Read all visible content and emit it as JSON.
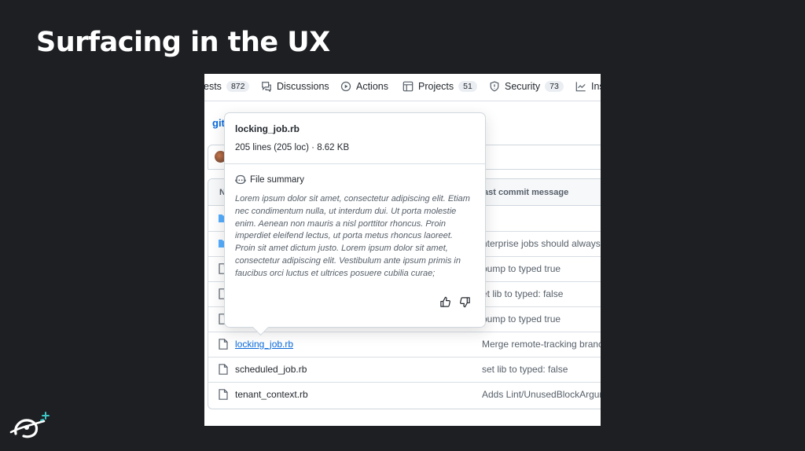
{
  "slide": {
    "title": "Surfacing in the UX"
  },
  "tabs": [
    {
      "label": "ests",
      "count": "872",
      "icon": "pull-request-icon"
    },
    {
      "label": "Discussions",
      "icon": "discussions-icon"
    },
    {
      "label": "Actions",
      "icon": "actions-icon"
    },
    {
      "label": "Projects",
      "count": "51",
      "icon": "projects-icon"
    },
    {
      "label": "Security",
      "count": "73",
      "icon": "shield-icon"
    },
    {
      "label": "Ins",
      "icon": "insights-icon"
    }
  ],
  "repo": {
    "link": "git"
  },
  "table": {
    "header_name": "N",
    "header_commit": "ast commit message",
    "rows": [
      {
        "type": "folder",
        "name": "",
        "message": ""
      },
      {
        "type": "folder",
        "name": "",
        "message": "nterprise jobs should always"
      },
      {
        "type": "file",
        "name": "",
        "message": "bump to typed true"
      },
      {
        "type": "file",
        "name": "",
        "message": "et lib to typed: false"
      },
      {
        "type": "file",
        "name": "",
        "message": "bump to typed true"
      },
      {
        "type": "file",
        "name": "locking_job.rb",
        "message": "Merge remote-tracking branch",
        "link": true
      },
      {
        "type": "file",
        "name": "scheduled_job.rb",
        "message": "set lib to typed: false"
      },
      {
        "type": "file",
        "name": "tenant_context.rb",
        "message": "Adds Lint/UnusedBlockArgum"
      }
    ]
  },
  "popover": {
    "filename": "locking_job.rb",
    "stats": "205 lines (205 loc) · 8.62 KB",
    "summary_heading": "File summary",
    "summary_text": "Lorem ipsum dolor sit amet, consectetur adipiscing elit. Etiam nec condimentum nulla, ut interdum dui. Ut porta molestie enim. Aenean non mauris a nisl porttitor rhoncus. Proin imperdiet eleifend lectus, ut porta metus rhoncus laoreet. Proin sit amet dictum justo. Lorem ipsum dolor sit amet, consectetur adipiscing elit. Vestibulum ante ipsum primis in faucibus orci luctus et ultrices posuere cubilia curae;"
  },
  "colors": {
    "background": "#1d1f22",
    "link": "#0969da",
    "folder": "#54aeff"
  }
}
